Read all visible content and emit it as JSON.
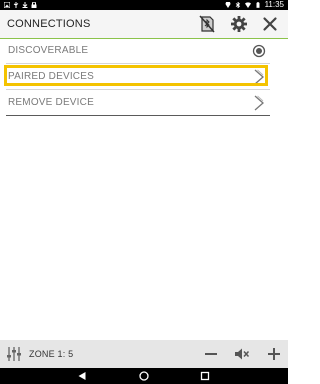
{
  "status_bar": {
    "time": "11:35",
    "left_icons": [
      "image-icon",
      "usb-icon",
      "download-icon",
      "lock-icon"
    ],
    "right_icons": [
      "location-icon",
      "bluetooth-icon",
      "wifi-icon",
      "battery-icon"
    ]
  },
  "header": {
    "title": "CONNECTIONS",
    "buttons": [
      "bluetooth-off-icon",
      "gear-icon",
      "close-icon"
    ]
  },
  "list": {
    "items": [
      {
        "label": "DISCOVERABLE",
        "trail": "radio-selected-icon"
      },
      {
        "label": "PAIRED DEVICES",
        "trail": "chevron-right-icon"
      },
      {
        "label": "REMOVE DEVICE",
        "trail": "chevron-right-icon"
      }
    ]
  },
  "footer": {
    "zone_label": "ZONE 1: 5",
    "buttons": [
      "minus-icon",
      "mute-icon",
      "plus-icon"
    ]
  },
  "nav": {
    "buttons": [
      "back-icon",
      "home-icon",
      "recents-icon"
    ]
  },
  "colors": {
    "accent_line": "#8bc34a",
    "highlight": "#f4c300",
    "header_bg": "#f5f5f5",
    "footer_bg": "#e6e6e6"
  }
}
